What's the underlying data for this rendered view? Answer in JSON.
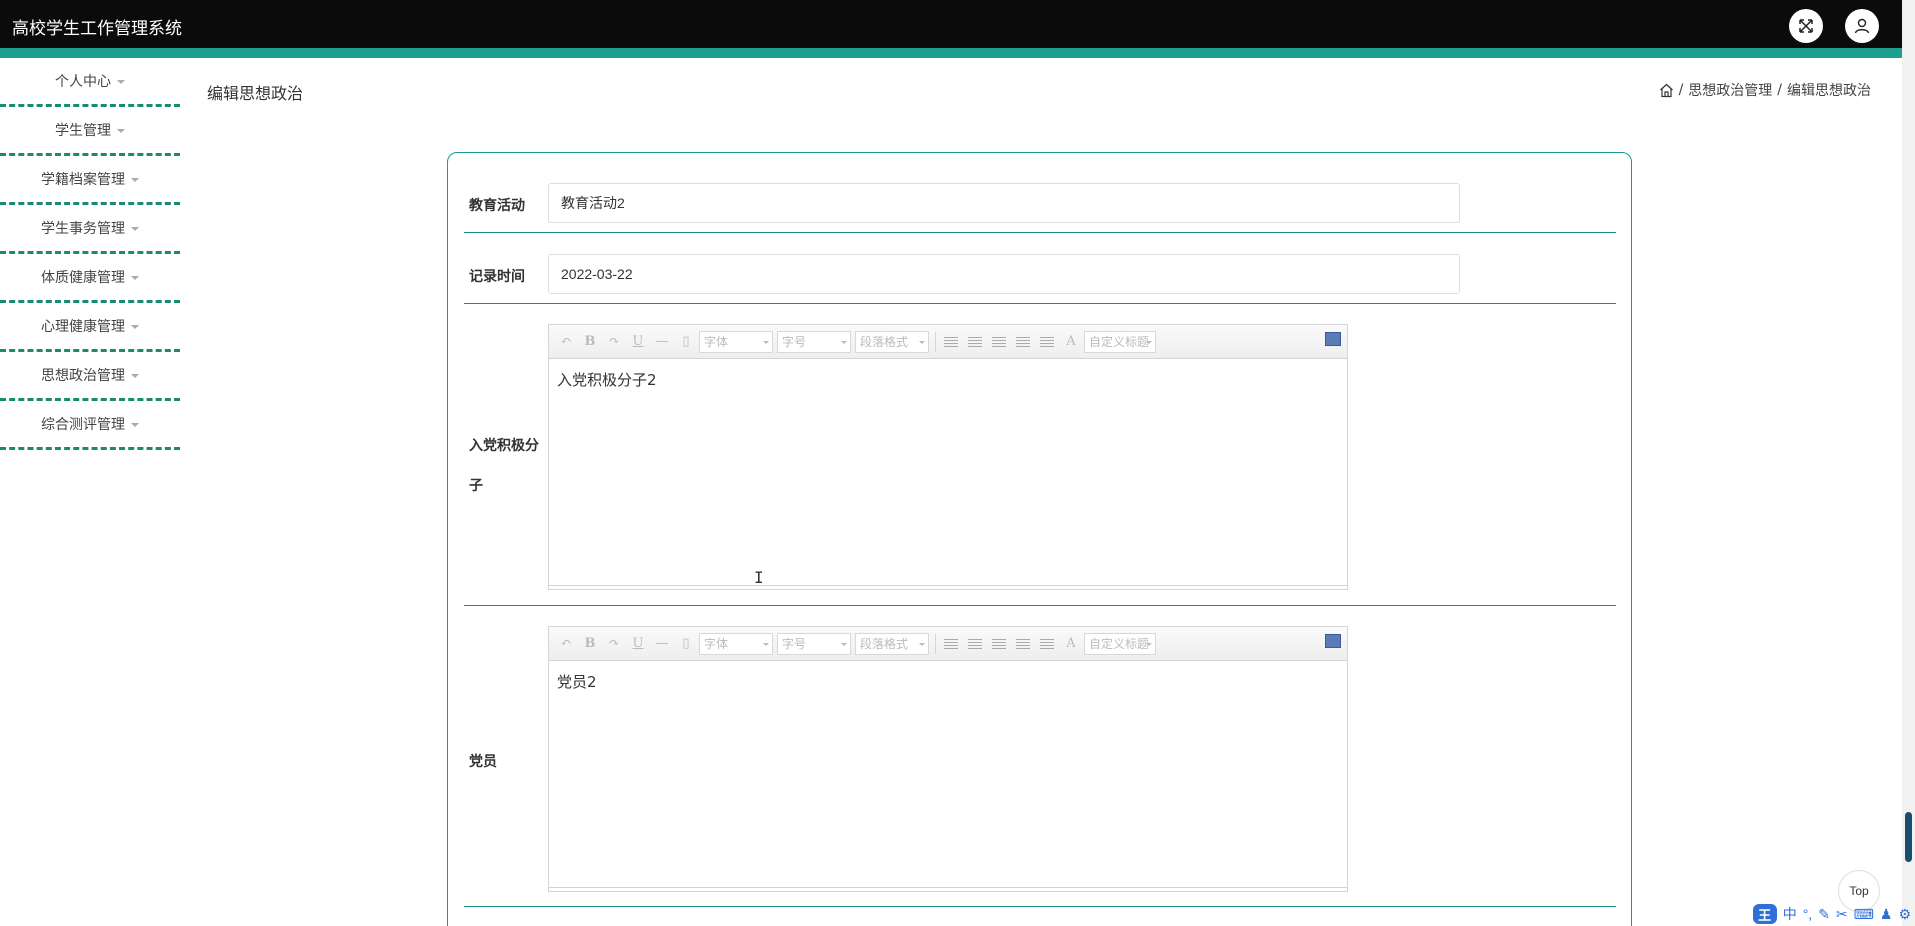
{
  "app": {
    "title": "高校学生工作管理系统"
  },
  "header": {
    "fullscreen_icon": "fullscreen-icon",
    "user_icon": "user-icon"
  },
  "sidebar": {
    "items": [
      {
        "label": "个人中心"
      },
      {
        "label": "学生管理"
      },
      {
        "label": "学籍档案管理"
      },
      {
        "label": "学生事务管理"
      },
      {
        "label": "体质健康管理"
      },
      {
        "label": "心理健康管理"
      },
      {
        "label": "思想政治管理"
      },
      {
        "label": "综合测评管理"
      }
    ]
  },
  "page": {
    "title": "编辑思想政治"
  },
  "breadcrumb": {
    "separator": "/",
    "items": [
      "思想政治管理",
      "编辑思想政治"
    ]
  },
  "form": {
    "education_activity": {
      "label": "教育活动",
      "value": "教育活动2"
    },
    "record_time": {
      "label": "记录时间",
      "value": "2022-03-22"
    },
    "party_activist": {
      "label": "入党积极分子",
      "content": "入党积极分子2"
    },
    "party_member": {
      "label": "党员",
      "content": "党员2"
    }
  },
  "editor_toolbar": {
    "bold": "B",
    "underline": "U",
    "hr": "—",
    "font_family": "字体",
    "font_size": "字号",
    "paragraph": "段落格式",
    "font_color": "A",
    "custom_title": "自定义标题"
  },
  "top_button": {
    "label": "Top"
  },
  "ime": {
    "logo": "王",
    "mode": "中",
    "punct": "°,"
  },
  "colors": {
    "accent": "#1e9e8f",
    "topbar": "#0b0b0b",
    "divider": "#1b8a72"
  }
}
